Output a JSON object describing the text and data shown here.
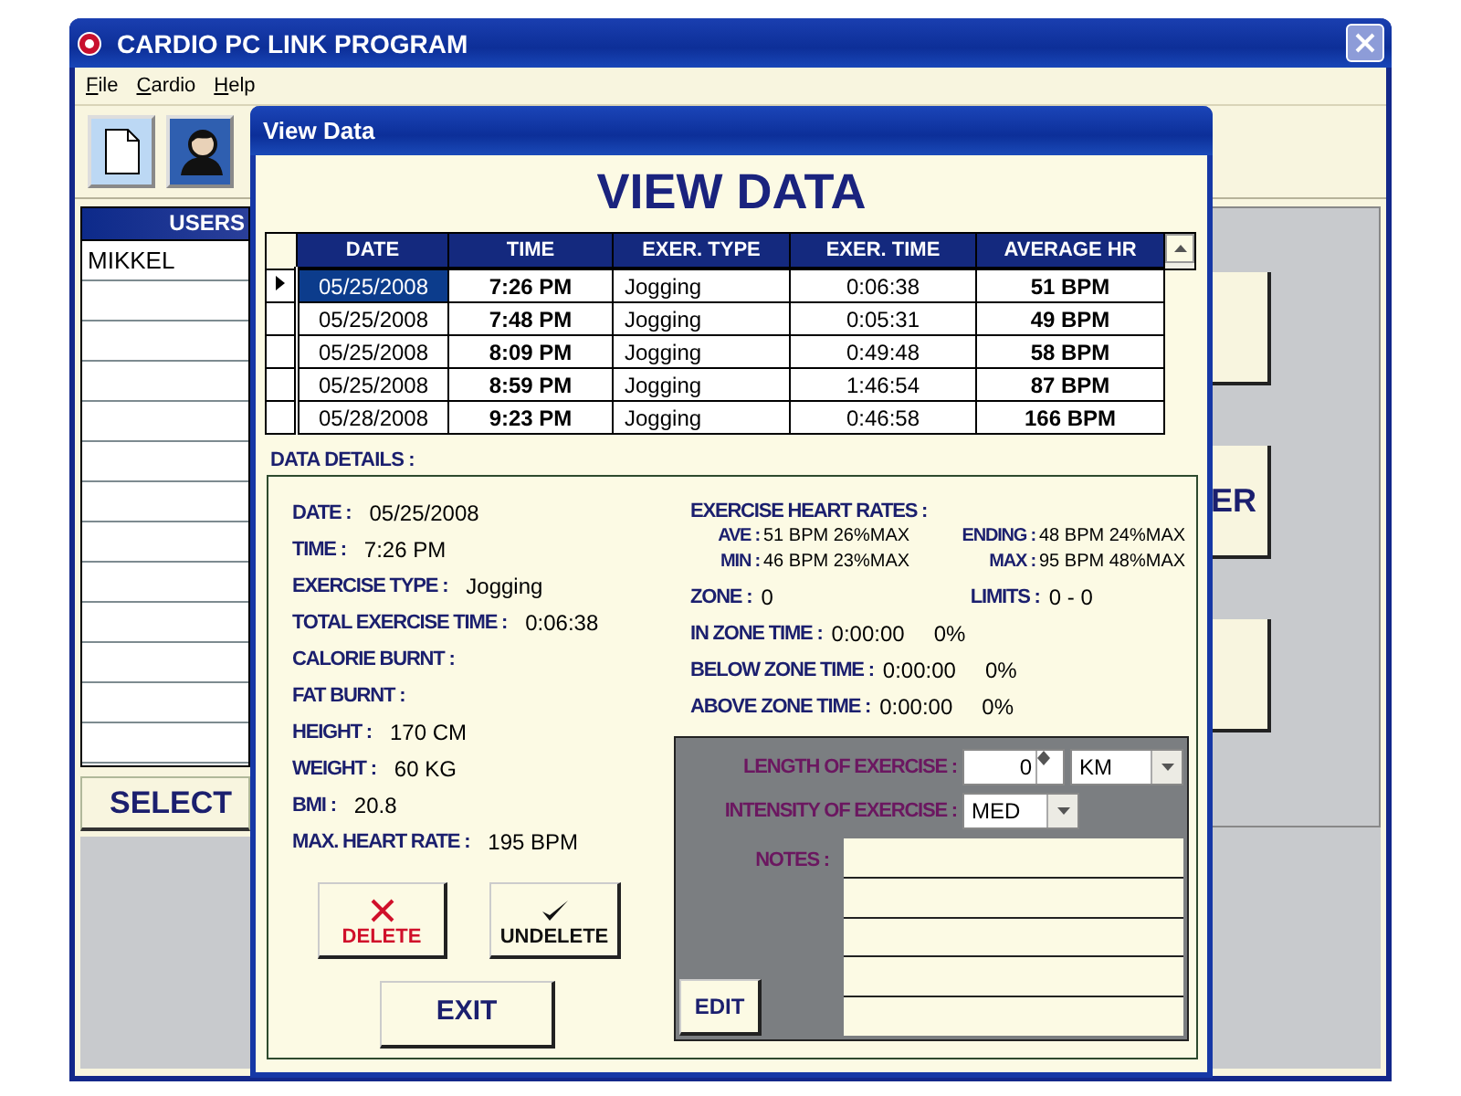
{
  "window": {
    "title": "CARDIO PC LINK PROGRAM"
  },
  "menu": [
    {
      "label": "File"
    },
    {
      "label": "Cardio"
    },
    {
      "label": "Help"
    }
  ],
  "users_panel": {
    "header": "USERS",
    "items": [
      "MIKKEL"
    ],
    "select_button": "SELECT"
  },
  "right_buttons": [
    {
      "kind": "blank"
    },
    {
      "kind": "text",
      "label": "ER"
    },
    {
      "kind": "blank"
    }
  ],
  "dialog": {
    "title": "View Data",
    "heading": "VIEW DATA",
    "table": {
      "columns": [
        "DATE",
        "TIME",
        "EXER. TYPE",
        "EXER. TIME",
        "AVERAGE HR"
      ],
      "rows": [
        {
          "selected": true,
          "cells": [
            "05/25/2008",
            "7:26 PM",
            "Jogging",
            "0:06:38",
            "51 BPM"
          ]
        },
        {
          "selected": false,
          "cells": [
            "05/25/2008",
            "7:48 PM",
            "Jogging",
            "0:05:31",
            "49 BPM"
          ]
        },
        {
          "selected": false,
          "cells": [
            "05/25/2008",
            "8:09 PM",
            "Jogging",
            "0:49:48",
            "58 BPM"
          ]
        },
        {
          "selected": false,
          "cells": [
            "05/25/2008",
            "8:59 PM",
            "Jogging",
            "1:46:54",
            "87 BPM"
          ]
        },
        {
          "selected": false,
          "cells": [
            "05/28/2008",
            "9:23 PM",
            "Jogging",
            "0:46:58",
            "166 BPM"
          ]
        }
      ]
    },
    "details_title": "DATA DETAILS :",
    "details": [
      {
        "label": "DATE :",
        "value": "05/25/2008"
      },
      {
        "label": "TIME :",
        "value": "7:26 PM"
      },
      {
        "label": "EXERCISE TYPE :",
        "value": "Jogging"
      },
      {
        "label": "TOTAL EXERCISE TIME :",
        "value": "0:06:38"
      },
      {
        "label": "CALORIE BURNT :"
      },
      {
        "label": "FAT BURNT :"
      },
      {
        "label": "HEIGHT :",
        "value": "170 CM"
      },
      {
        "label": "WEIGHT :",
        "value": "60 KG"
      },
      {
        "label": "BMI :",
        "value": "20.8"
      },
      {
        "label": "MAX. HEART RATE :",
        "value": "195 BPM"
      }
    ],
    "heart_rates": {
      "title": "EXERCISE HEART RATES :",
      "items": [
        {
          "label": "AVE :",
          "value": "51 BPM 26%MAX"
        },
        {
          "label": "ENDING :",
          "value": "48 BPM 24%MAX"
        },
        {
          "label": "MIN :",
          "value": "46 BPM 23%MAX"
        },
        {
          "label": "MAX :",
          "value": "95 BPM 48%MAX"
        }
      ]
    },
    "zone": {
      "label": "ZONE :",
      "value": "0"
    },
    "limits": {
      "label": "LIMITS :",
      "value": "0 - 0"
    },
    "zone_times": [
      {
        "label": "IN ZONE TIME :",
        "value": "0:00:00",
        "percent": "0%"
      },
      {
        "label": "BELOW ZONE TIME :",
        "value": "0:00:00",
        "percent": "0%"
      },
      {
        "label": "ABOVE ZONE TIME :",
        "value": "0:00:00",
        "percent": "0%"
      }
    ],
    "exercise": {
      "length_label": "LENGTH OF EXERCISE :",
      "length_value": "0",
      "unit": "KM",
      "intensity_label": "INTENSITY OF EXERCISE :",
      "intensity": "MED",
      "notes_label": "NOTES :",
      "edit_button": "EDIT"
    },
    "buttons": [
      {
        "kind": "delete",
        "label": "DELETE"
      },
      {
        "kind": "undelete",
        "label": "UNDELETE"
      },
      {
        "kind": "exit",
        "label": "EXIT"
      }
    ]
  }
}
